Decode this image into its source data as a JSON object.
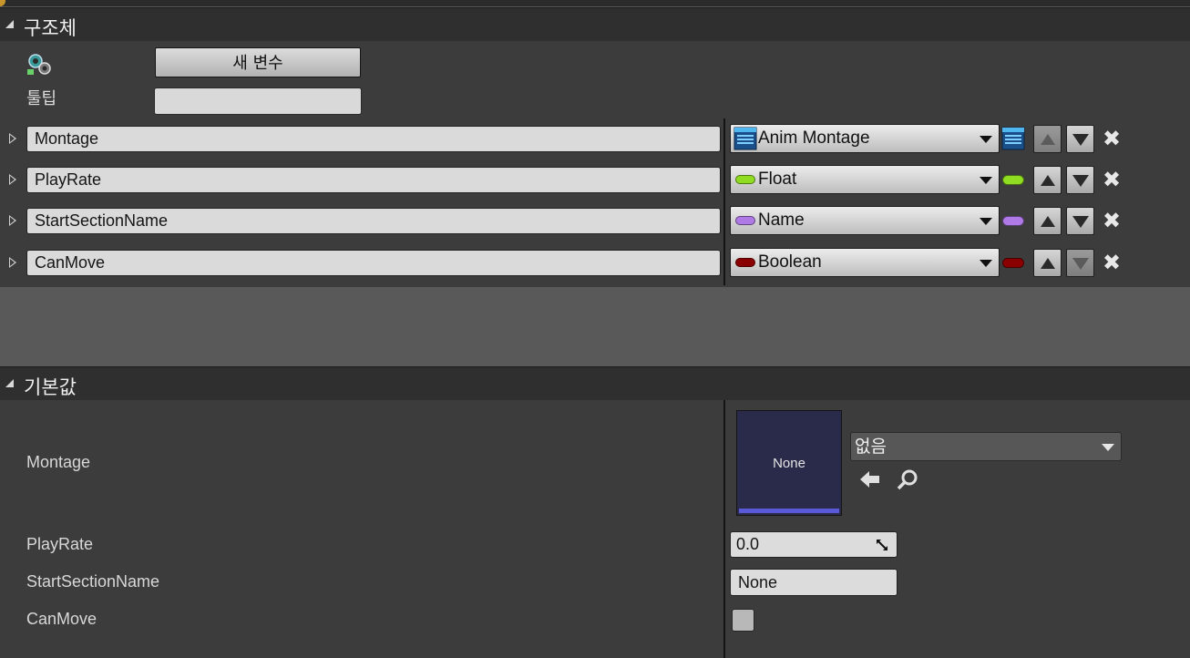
{
  "structure_section": {
    "title": "구조체",
    "new_variable_button": "새 변수",
    "tooltip_label": "툴팁",
    "tooltip_value": ""
  },
  "members": [
    {
      "name": "Montage",
      "type": "Anim Montage",
      "type_color": "#2aa6e6",
      "down_enabled": true
    },
    {
      "name": "PlayRate",
      "type": "Float",
      "type_color": "#8fdc22",
      "down_enabled": true
    },
    {
      "name": "StartSectionName",
      "type": "Name",
      "type_color": "#b07ae6",
      "down_enabled": true
    },
    {
      "name": "CanMove",
      "type": "Boolean",
      "type_color": "#8a0000",
      "down_enabled": false
    }
  ],
  "defaults_section": {
    "title": "기본값",
    "montage": {
      "label": "Montage",
      "thumbnail_text": "None",
      "asset_value": "없음"
    },
    "playrate": {
      "label": "PlayRate",
      "value": "0.0"
    },
    "startsection": {
      "label": "StartSectionName",
      "value": "None"
    },
    "canmove": {
      "label": "CanMove",
      "checked": false
    }
  },
  "icons": {
    "variables": "gear-variables-icon",
    "use_selected": "arrow-left-icon",
    "browse": "search-icon",
    "remove": "close-icon"
  }
}
